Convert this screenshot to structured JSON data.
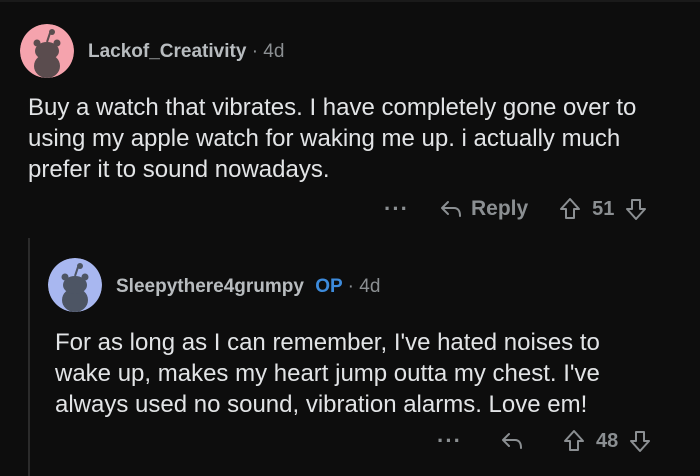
{
  "comments": [
    {
      "username": "Lackof_Creativity",
      "op_badge": "",
      "separator": "·",
      "age": "4d",
      "body": "Buy a watch that vibrates. I have completely gone over to using my apple watch for waking me up. i actually much prefer it to sound nowadays.",
      "more": "···",
      "reply_label": "Reply",
      "score": "51",
      "avatar_color": "#f5a3ad"
    },
    {
      "username": "Sleepythere4grumpy",
      "op_badge": "OP",
      "separator": "·",
      "age": "4d",
      "body": "For as long as I can remember, I've hated noises to wake up, makes my heart jump outta my chest. I've always used no sound, vibration alarms. Love em!",
      "more": "···",
      "reply_label": "",
      "score": "48",
      "avatar_color": "#a8b7f0"
    }
  ],
  "colors": {
    "background": "#0d0d0d",
    "op": "#3d8bdc",
    "muted": "#8b8f92"
  }
}
